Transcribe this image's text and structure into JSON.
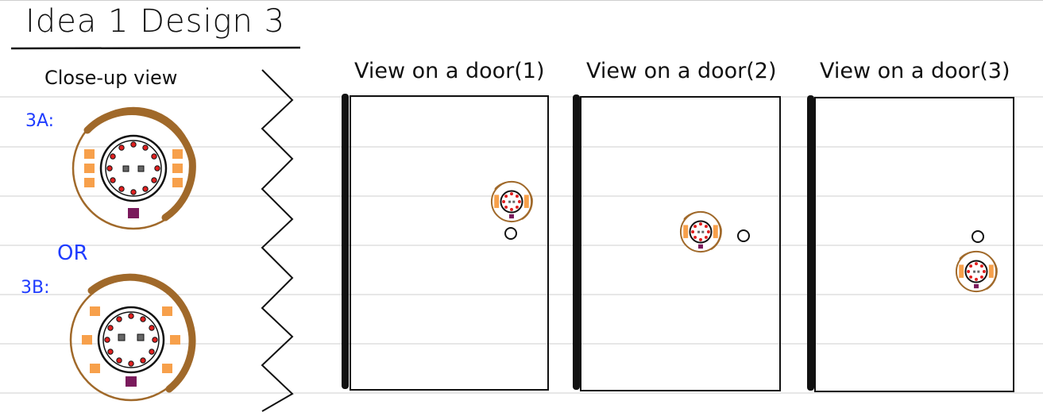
{
  "title": "Idea 1 Design 3",
  "closeup_label": "Close-up view",
  "option_a_label": "3A:",
  "or_label": "OR",
  "option_b_label": "3B:",
  "door_views": [
    {
      "label": "View on a door(1)"
    },
    {
      "label": "View on a door(2)"
    },
    {
      "label": "View on a door(3)"
    }
  ],
  "colors": {
    "ring": "#a0692a",
    "led": "#e02020",
    "pad": "#f7a04b",
    "button": "#7a1a5c",
    "annotation_blue": "#1f3cff",
    "ruled_line": "#c8c8c8",
    "ink": "#111111"
  },
  "icons": [
    "lock-device-icon",
    "door-handle-icon",
    "zigzag-break-icon"
  ]
}
